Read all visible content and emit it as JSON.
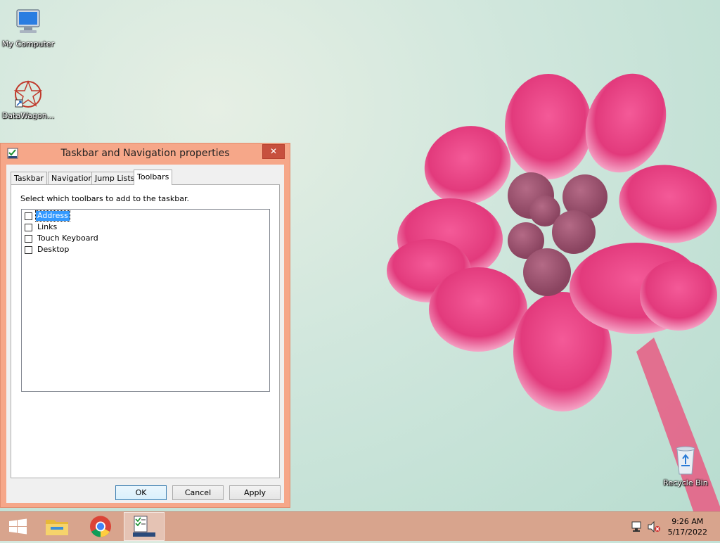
{
  "desktop": {
    "icons": [
      {
        "label": "My Computer",
        "icon": "computer-icon"
      },
      {
        "label": "DataWagon...",
        "icon": "datawagon-icon"
      },
      {
        "label": "Recycle Bin",
        "icon": "recycle-bin-icon"
      }
    ]
  },
  "dialog": {
    "title": "Taskbar and Navigation properties",
    "close_glyph": "✕",
    "tabs": [
      "Taskbar",
      "Navigation",
      "Jump Lists",
      "Toolbars"
    ],
    "active_tab": "Toolbars",
    "instruction": "Select which toolbars to add to the taskbar.",
    "toolbars": [
      {
        "label": "Address",
        "checked": false,
        "selected": true
      },
      {
        "label": "Links",
        "checked": false,
        "selected": false
      },
      {
        "label": "Touch Keyboard",
        "checked": false,
        "selected": false
      },
      {
        "label": "Desktop",
        "checked": false,
        "selected": false
      }
    ],
    "buttons": {
      "ok": "OK",
      "cancel": "Cancel",
      "apply": "Apply"
    }
  },
  "taskbar": {
    "buttons": [
      {
        "name": "start",
        "icon": "windows-logo-icon"
      },
      {
        "name": "file-explorer",
        "icon": "folder-icon"
      },
      {
        "name": "chrome",
        "icon": "chrome-icon"
      },
      {
        "name": "taskbar-properties",
        "icon": "taskbar-properties-icon",
        "active": true
      }
    ],
    "tray": {
      "icons": [
        "network-icon",
        "volume-muted-icon"
      ],
      "time": "9:26 AM",
      "date": "5/17/2022"
    }
  },
  "colors": {
    "window_frame": "#f6a789",
    "taskbar": "#d8a48d",
    "selection": "#3399ff",
    "flower": "#e8417f"
  }
}
